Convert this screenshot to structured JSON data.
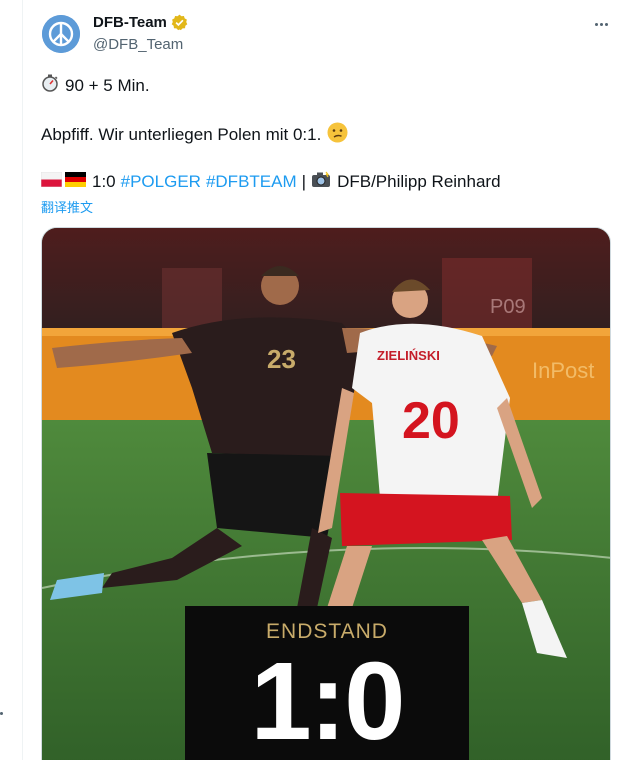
{
  "tweet": {
    "display_name": "DFB-Team",
    "handle": "@DFB_Team",
    "verified_color": "#e2b719",
    "line1": {
      "emoji_icon": "stopwatch-icon",
      "text": "90 + 5 Min."
    },
    "line2": {
      "text": "Abpfiff. Wir unterliegen Polen mit 0:1.",
      "emoji_icon": "confused-face-icon"
    },
    "line3": {
      "flags": [
        "poland-flag-icon",
        "germany-flag-icon"
      ],
      "score_text": "1:0",
      "hashtag1": "#POLGER",
      "hashtag2": "#DFBTEAM",
      "separator": "|",
      "camera_icon": "camera-flash-icon",
      "credit": "DFB/Philipp Reinhard"
    },
    "translate_label": "翻译推文"
  },
  "photo": {
    "jersey_name": "ZIELIŃSKI",
    "jersey_number_red": "20",
    "jersey_number_dark": "23",
    "board_text": "InPost",
    "board_text2": "P09",
    "score_overlay": {
      "label": "ENDSTAND",
      "value": "1:0"
    }
  },
  "colors": {
    "accent": "#1d9bf0",
    "text": "#0f1419",
    "muted": "#536471"
  }
}
